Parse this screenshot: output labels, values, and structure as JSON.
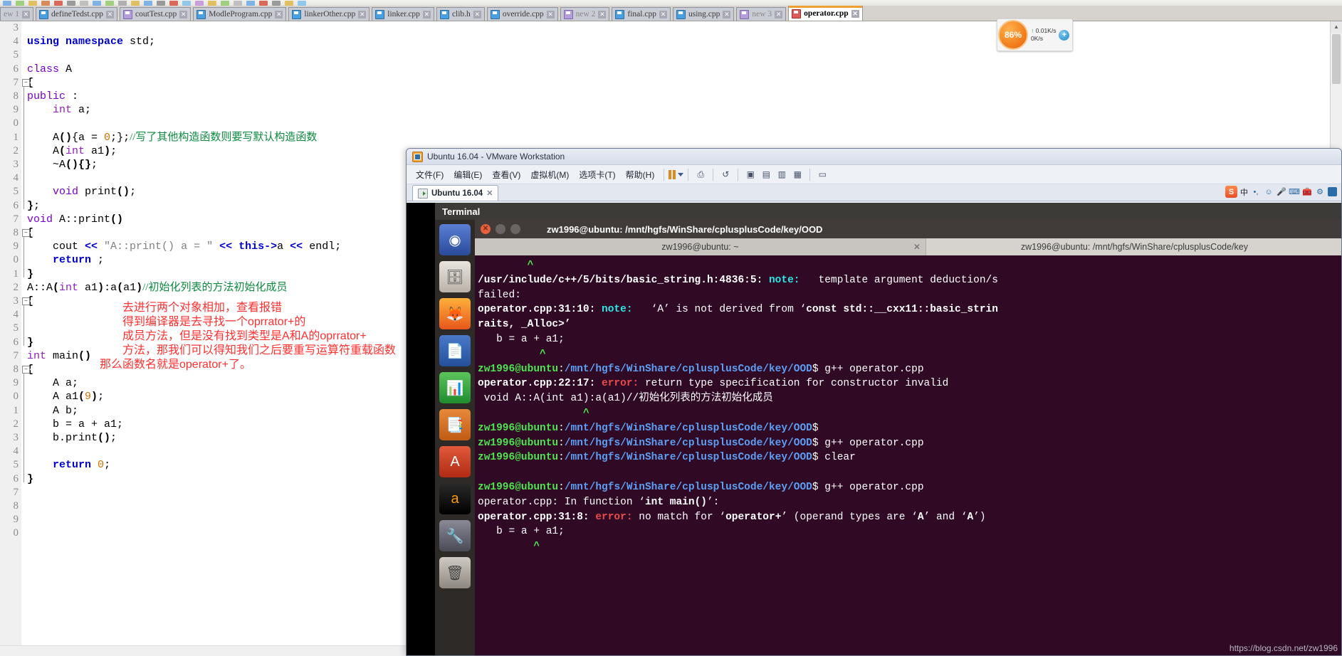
{
  "ide": {
    "tabs": [
      {
        "label": "ew 1",
        "icon": "file-icon",
        "active": false,
        "dim": true,
        "cut": true
      },
      {
        "label": "defineTedst.cpp",
        "icon": "file-icon",
        "active": false
      },
      {
        "label": "coutTest.cpp",
        "icon": "file-icon-violet",
        "active": false
      },
      {
        "label": "ModleProgram.cpp",
        "icon": "file-icon",
        "active": false
      },
      {
        "label": "linkerOther.cpp",
        "icon": "file-icon",
        "active": false
      },
      {
        "label": "linker.cpp",
        "icon": "file-icon",
        "active": false
      },
      {
        "label": "clib.h",
        "icon": "file-icon",
        "active": false
      },
      {
        "label": "override.cpp",
        "icon": "file-icon",
        "active": false
      },
      {
        "label": "new 2",
        "icon": "file-icon-violet",
        "active": false,
        "dim": true
      },
      {
        "label": "final.cpp",
        "icon": "file-icon",
        "active": false
      },
      {
        "label": "using.cpp",
        "icon": "file-icon",
        "active": false
      },
      {
        "label": "new 3",
        "icon": "file-icon-violet",
        "active": false,
        "dim": true
      },
      {
        "label": "operator.cpp",
        "icon": "file-icon-red",
        "active": true
      }
    ],
    "close_glyph": "✕",
    "line_numbers": [
      "3",
      "4",
      "5",
      "6",
      "7",
      "8",
      "9",
      "0",
      "1",
      "2",
      "3",
      "4",
      "5",
      "6",
      "7",
      "8",
      "9",
      "0",
      "1",
      "2",
      "3",
      "4",
      "5",
      "6",
      "7",
      "8",
      "9",
      "0",
      "1",
      "2",
      "3",
      "4",
      "5",
      "6",
      "7",
      "8",
      "9",
      "0"
    ],
    "code_lines": [
      {
        "n": 3,
        "segs": []
      },
      {
        "n": 4,
        "segs": [
          {
            "t": "using",
            "c": "kw"
          },
          {
            "t": " ",
            "c": "plain"
          },
          {
            "t": "namespace",
            "c": "kw"
          },
          {
            "t": " std;",
            "c": "plain"
          }
        ]
      },
      {
        "n": 5,
        "segs": []
      },
      {
        "n": 6,
        "segs": [
          {
            "t": "class",
            "c": "kw2"
          },
          {
            "t": " A",
            "c": "plain"
          }
        ]
      },
      {
        "n": 7,
        "segs": [
          {
            "t": "{",
            "c": "pun"
          }
        ]
      },
      {
        "n": 8,
        "segs": [
          {
            "t": "public",
            "c": "kw2"
          },
          {
            "t": " :",
            "c": "plain"
          }
        ]
      },
      {
        "n": 9,
        "segs": [
          {
            "t": "    ",
            "c": "plain"
          },
          {
            "t": "int",
            "c": "type"
          },
          {
            "t": " a;",
            "c": "plain"
          }
        ]
      },
      {
        "n": 10,
        "segs": []
      },
      {
        "n": 11,
        "segs": [
          {
            "t": "    A",
            "c": "plain"
          },
          {
            "t": "()",
            "c": "pun"
          },
          {
            "t": "{a = ",
            "c": "plain"
          },
          {
            "t": "0",
            "c": "num"
          },
          {
            "t": ";}",
            "c": "plain"
          },
          {
            "t": ";",
            "c": "plain"
          },
          {
            "t": "//写了其他构造函数则要写默认构造函数",
            "c": "cmt"
          }
        ]
      },
      {
        "n": 12,
        "segs": [
          {
            "t": "    A",
            "c": "plain"
          },
          {
            "t": "(",
            "c": "pun"
          },
          {
            "t": "int",
            "c": "type"
          },
          {
            "t": " a1",
            "c": "plain"
          },
          {
            "t": ")",
            "c": "pun"
          },
          {
            "t": ";",
            "c": "plain"
          }
        ]
      },
      {
        "n": 13,
        "segs": [
          {
            "t": "    ~A",
            "c": "plain"
          },
          {
            "t": "(){}",
            "c": "pun"
          },
          {
            "t": ";",
            "c": "plain"
          }
        ]
      },
      {
        "n": 14,
        "segs": []
      },
      {
        "n": 15,
        "segs": [
          {
            "t": "    ",
            "c": "plain"
          },
          {
            "t": "void",
            "c": "kw2"
          },
          {
            "t": " print",
            "c": "plain"
          },
          {
            "t": "()",
            "c": "pun"
          },
          {
            "t": ";",
            "c": "plain"
          }
        ]
      },
      {
        "n": 16,
        "segs": [
          {
            "t": "}",
            "c": "pun"
          },
          {
            "t": ";",
            "c": "plain"
          }
        ]
      },
      {
        "n": 17,
        "segs": [
          {
            "t": "void",
            "c": "kw2"
          },
          {
            "t": " A::print",
            "c": "plain"
          },
          {
            "t": "()",
            "c": "pun"
          }
        ]
      },
      {
        "n": 18,
        "segs": [
          {
            "t": "{",
            "c": "pun"
          }
        ]
      },
      {
        "n": 19,
        "segs": [
          {
            "t": "    cout ",
            "c": "plain"
          },
          {
            "t": "<<",
            "c": "kw"
          },
          {
            "t": " ",
            "c": "plain"
          },
          {
            "t": "\"A::print() a = \"",
            "c": "str"
          },
          {
            "t": " ",
            "c": "plain"
          },
          {
            "t": "<<",
            "c": "kw"
          },
          {
            "t": " ",
            "c": "plain"
          },
          {
            "t": "this",
            "c": "kw"
          },
          {
            "t": "->",
            "c": "kw"
          },
          {
            "t": "a ",
            "c": "plain"
          },
          {
            "t": "<<",
            "c": "kw"
          },
          {
            "t": " endl;",
            "c": "plain"
          }
        ]
      },
      {
        "n": 20,
        "segs": [
          {
            "t": "    ",
            "c": "plain"
          },
          {
            "t": "return",
            "c": "kw"
          },
          {
            "t": " ;",
            "c": "plain"
          }
        ]
      },
      {
        "n": 21,
        "segs": [
          {
            "t": "}",
            "c": "pun"
          }
        ]
      },
      {
        "n": 22,
        "segs": [
          {
            "t": "A::A",
            "c": "plain"
          },
          {
            "t": "(",
            "c": "pun"
          },
          {
            "t": "int",
            "c": "type"
          },
          {
            "t": " a1",
            "c": "plain"
          },
          {
            "t": ")",
            "c": "pun"
          },
          {
            "t": ":a",
            "c": "plain"
          },
          {
            "t": "(",
            "c": "pun"
          },
          {
            "t": "a1",
            "c": "plain"
          },
          {
            "t": ")",
            "c": "pun"
          },
          {
            "t": "//初始化列表的方法初始化成员",
            "c": "cmt"
          }
        ]
      },
      {
        "n": 23,
        "segs": [
          {
            "t": "{",
            "c": "pun"
          }
        ]
      },
      {
        "n": 24,
        "segs": []
      },
      {
        "n": 25,
        "segs": []
      },
      {
        "n": 26,
        "segs": [
          {
            "t": "}",
            "c": "pun"
          }
        ]
      },
      {
        "n": 27,
        "segs": [
          {
            "t": "int",
            "c": "type"
          },
          {
            "t": " main",
            "c": "plain"
          },
          {
            "t": "()",
            "c": "pun"
          }
        ]
      },
      {
        "n": 28,
        "segs": [
          {
            "t": "{",
            "c": "pun"
          }
        ]
      },
      {
        "n": 29,
        "segs": [
          {
            "t": "    A a;",
            "c": "plain"
          }
        ]
      },
      {
        "n": 30,
        "segs": [
          {
            "t": "    A a1",
            "c": "plain"
          },
          {
            "t": "(",
            "c": "pun"
          },
          {
            "t": "9",
            "c": "num"
          },
          {
            "t": ")",
            "c": "pun"
          },
          {
            "t": ";",
            "c": "plain"
          }
        ]
      },
      {
        "n": 31,
        "segs": [
          {
            "t": "    A b;",
            "c": "plain"
          }
        ]
      },
      {
        "n": 32,
        "segs": [
          {
            "t": "    b = a + a1;",
            "c": "plain"
          }
        ]
      },
      {
        "n": 33,
        "segs": [
          {
            "t": "    b.print",
            "c": "plain"
          },
          {
            "t": "()",
            "c": "pun"
          },
          {
            "t": ";",
            "c": "plain"
          }
        ]
      },
      {
        "n": 34,
        "segs": []
      },
      {
        "n": 35,
        "segs": [
          {
            "t": "    ",
            "c": "plain"
          },
          {
            "t": "return",
            "c": "kw"
          },
          {
            "t": " ",
            "c": "plain"
          },
          {
            "t": "0",
            "c": "num"
          },
          {
            "t": ";",
            "c": "plain"
          }
        ]
      },
      {
        "n": 36,
        "segs": [
          {
            "t": "}",
            "c": "pun"
          }
        ]
      }
    ],
    "annotations": [
      "去进行两个对象相加，查看报错",
      "得到编译器是去寻找一个oprrator+的",
      "成员方法，但是没有找到类型是A和A的oprrator+",
      "方法，那我们可以得知我们之后要重写运算符重载函数",
      "那么函数名就是operator+了。"
    ],
    "monitor": {
      "cpu_percent": "86%",
      "up_rate": "0.01K/s",
      "down_rate": "0K/s",
      "plus_glyph": "+"
    }
  },
  "vmware": {
    "title": "Ubuntu 16.04 - VMware Workstation",
    "menu": [
      "文件(F)",
      "编辑(E)",
      "查看(V)",
      "虚拟机(M)",
      "选项卡(T)",
      "帮助(H)"
    ],
    "tab": {
      "label": "Ubuntu 16.04",
      "close": "✕"
    },
    "tray": {
      "ime_badge": "S",
      "ime_mode": "中",
      "icons": [
        "sogou-icon",
        "ime-chinese-icon",
        "half-width-icon",
        "smiley-icon",
        "mic-icon",
        "keyboard-icon",
        "toolbox-icon",
        "settings-icon",
        "panel-icon"
      ]
    },
    "toolbar_icons": [
      "pause-icon",
      "dropdown-caret-icon",
      "snapshot-icon",
      "revert-icon",
      "fullscreen-icon",
      "unity-icon",
      "layout-1-icon",
      "layout-2-icon",
      "layout-3-icon",
      "layout-4-icon",
      "console-icon"
    ]
  },
  "guest": {
    "topbar_title": "Terminal",
    "launcher_icons": [
      "ubuntu-dash-icon",
      "files-icon",
      "firefox-icon",
      "libreoffice-writer-icon",
      "libreoffice-calc-icon",
      "libreoffice-impress-icon",
      "software-center-icon",
      "amazon-icon",
      "system-settings-icon",
      "trash-icon"
    ],
    "terminal": {
      "window_title": "zw1996@ubuntu: /mnt/hgfs/WinShare/cplusplusCode/key/OOD",
      "tabs": [
        {
          "label": "zw1996@ubuntu: ~",
          "selected": true,
          "close": "✕"
        },
        {
          "label": "zw1996@ubuntu: /mnt/hgfs/WinShare/cplusplusCode/key",
          "selected": false
        }
      ],
      "lines": [
        [
          {
            "t": "        ",
            "c": "t-white"
          },
          {
            "t": "^",
            "c": "t-green"
          }
        ],
        [
          {
            "t": "/usr/include/c++/5/bits/basic_string.h:4836:5: ",
            "c": "t-bold"
          },
          {
            "t": "note:",
            "c": "t-cyan"
          },
          {
            "t": "   template argument deduction/s",
            "c": "t-white"
          }
        ],
        [
          {
            "t": "failed:",
            "c": "t-white"
          }
        ],
        [
          {
            "t": "operator.cpp:31:10: ",
            "c": "t-bold"
          },
          {
            "t": "note:",
            "c": "t-cyan"
          },
          {
            "t": "   ‘A’ is not derived from ‘",
            "c": "t-white"
          },
          {
            "t": "const std::__cxx11::basic_strin",
            "c": "t-bold"
          }
        ],
        [
          {
            "t": "raits, _Alloc>’",
            "c": "t-bold"
          }
        ],
        [
          {
            "t": "   b = a + a1;",
            "c": "t-white"
          }
        ],
        [
          {
            "t": "          ",
            "c": "t-white"
          },
          {
            "t": "^",
            "c": "t-green"
          }
        ],
        [
          {
            "t": "zw1996@ubuntu",
            "c": "t-user"
          },
          {
            "t": ":",
            "c": "t-white"
          },
          {
            "t": "/mnt/hgfs/WinShare/cplusplusCode/key/OOD",
            "c": "t-path"
          },
          {
            "t": "$ g++ operator.cpp",
            "c": "t-white"
          }
        ],
        [
          {
            "t": "operator.cpp:22:17: ",
            "c": "t-bold"
          },
          {
            "t": "error:",
            "c": "t-red"
          },
          {
            "t": " return type specification for constructor invalid",
            "c": "t-white"
          }
        ],
        [
          {
            "t": " void A::A(int a1):a(a1)//初始化列表的方法初始化成员",
            "c": "t-white"
          }
        ],
        [
          {
            "t": "                 ",
            "c": "t-white"
          },
          {
            "t": "^",
            "c": "t-green"
          }
        ],
        [
          {
            "t": "zw1996@ubuntu",
            "c": "t-user"
          },
          {
            "t": ":",
            "c": "t-white"
          },
          {
            "t": "/mnt/hgfs/WinShare/cplusplusCode/key/OOD",
            "c": "t-path"
          },
          {
            "t": "$",
            "c": "t-white"
          }
        ],
        [
          {
            "t": "zw1996@ubuntu",
            "c": "t-user"
          },
          {
            "t": ":",
            "c": "t-white"
          },
          {
            "t": "/mnt/hgfs/WinShare/cplusplusCode/key/OOD",
            "c": "t-path"
          },
          {
            "t": "$ g++ operator.cpp",
            "c": "t-white"
          }
        ],
        [
          {
            "t": "zw1996@ubuntu",
            "c": "t-user"
          },
          {
            "t": ":",
            "c": "t-white"
          },
          {
            "t": "/mnt/hgfs/WinShare/cplusplusCode/key/OOD",
            "c": "t-path"
          },
          {
            "t": "$ clear",
            "c": "t-white"
          }
        ],
        [
          {
            "t": "",
            "c": "t-white"
          }
        ],
        [
          {
            "t": "zw1996@ubuntu",
            "c": "t-user"
          },
          {
            "t": ":",
            "c": "t-white"
          },
          {
            "t": "/mnt/hgfs/WinShare/cplusplusCode/key/OOD",
            "c": "t-path"
          },
          {
            "t": "$ g++ operator.cpp",
            "c": "t-white"
          }
        ],
        [
          {
            "t": "operator.cpp: In function ‘",
            "c": "t-white"
          },
          {
            "t": "int main()",
            "c": "t-bold"
          },
          {
            "t": "’:",
            "c": "t-white"
          }
        ],
        [
          {
            "t": "operator.cpp:31:8: ",
            "c": "t-bold"
          },
          {
            "t": "error:",
            "c": "t-red"
          },
          {
            "t": " no match for ‘",
            "c": "t-white"
          },
          {
            "t": "operator+",
            "c": "t-bold"
          },
          {
            "t": "’ (operand types are ‘",
            "c": "t-white"
          },
          {
            "t": "A",
            "c": "t-bold"
          },
          {
            "t": "’ and ‘",
            "c": "t-white"
          },
          {
            "t": "A",
            "c": "t-bold"
          },
          {
            "t": "’)",
            "c": "t-white"
          }
        ],
        [
          {
            "t": "   b = a + a1;",
            "c": "t-white"
          }
        ],
        [
          {
            "t": "         ",
            "c": "t-white"
          },
          {
            "t": "^",
            "c": "t-green"
          }
        ]
      ]
    }
  },
  "watermark": "https://blog.csdn.net/zw1996"
}
